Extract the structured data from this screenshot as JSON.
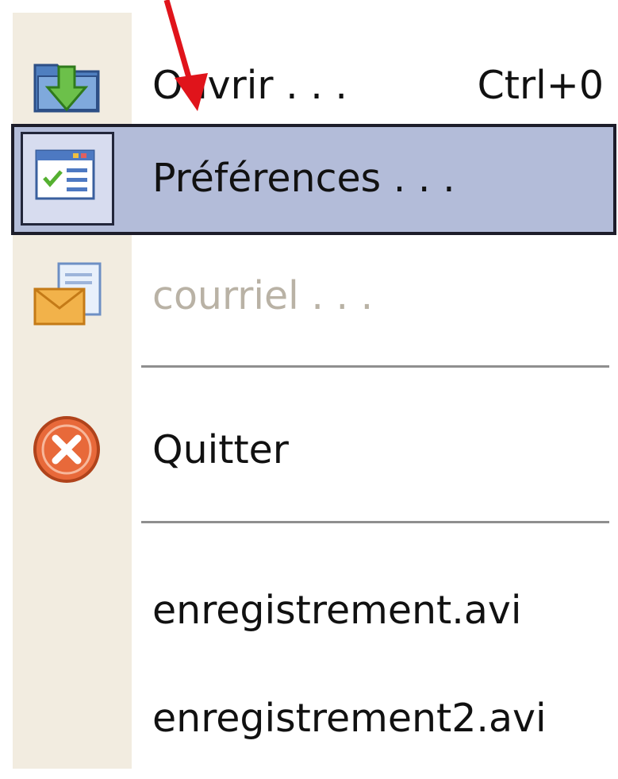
{
  "menu": {
    "items": [
      {
        "id": "open",
        "label": "Ouvrir . . .",
        "shortcut": "Ctrl+0",
        "icon": "open-folder-icon",
        "state": "normal"
      },
      {
        "id": "preferences",
        "label": "Préférences . . .",
        "shortcut": "",
        "icon": "preferences-icon",
        "state": "highlighted"
      },
      {
        "id": "email",
        "label": "courriel . . .",
        "shortcut": "",
        "icon": "email-icon",
        "state": "disabled"
      },
      {
        "id": "quit",
        "label": "Quitter",
        "shortcut": "",
        "icon": "quit-icon",
        "state": "normal"
      },
      {
        "id": "recent1",
        "label": "enregistrement.avi",
        "shortcut": "",
        "state": "normal"
      },
      {
        "id": "recent2",
        "label": "enregistrement2.avi",
        "shortcut": "",
        "state": "normal"
      }
    ]
  },
  "colors": {
    "gutter": "#f2ece0",
    "highlight": "#b3bcd9",
    "highlight_border": "#1d1d2a",
    "disabled_text": "#b9b2a5",
    "annotation_arrow": "#e0141b"
  }
}
